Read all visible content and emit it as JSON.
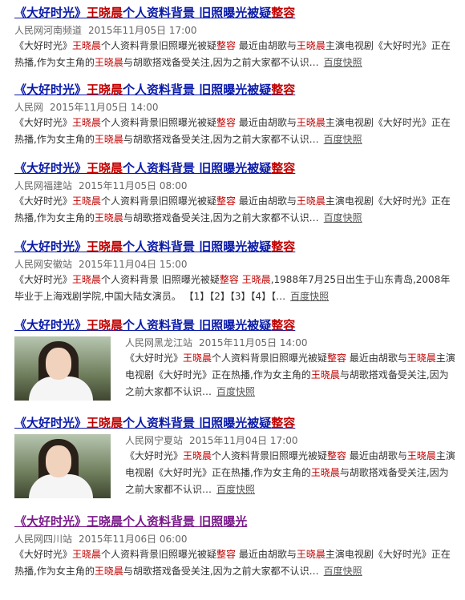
{
  "results": [
    {
      "title": [
        "《大好时光》",
        "王晓晨",
        "个人资料背景 旧照曝光被疑",
        "整容"
      ],
      "source": "人民网河南频道",
      "date": "2015年11月05日 17:00",
      "snippet": [
        "《大好时光》",
        "王晓晨",
        "个人资料背景旧照曝光被疑",
        "整容",
        " 最近由胡歌与",
        "王晓晨",
        "主演电视剧《大好时光》正在热播,作为女主角的",
        "王晓晨",
        "与胡歌搭戏备受关注,因为之前大家都不认识…"
      ],
      "cache": "百度快照"
    },
    {
      "title": [
        "《大好时光》",
        "王晓晨",
        "个人资料背景 旧照曝光被疑",
        "整容"
      ],
      "source": "人民网",
      "date": "2015年11月05日 14:00",
      "snippet": [
        "《大好时光》",
        "王晓晨",
        "个人资料背景旧照曝光被疑",
        "整容",
        " 最近由胡歌与",
        "王晓晨",
        "主演电视剧《大好时光》正在热播,作为女主角的",
        "王晓晨",
        "与胡歌搭戏备受关注,因为之前大家都不认识…"
      ],
      "cache": "百度快照"
    },
    {
      "title": [
        "《大好时光》",
        "王晓晨",
        "个人资料背景 旧照曝光被疑",
        "整容"
      ],
      "source": "人民网福建站",
      "date": "2015年11月05日 08:00",
      "snippet": [
        "《大好时光》",
        "王晓晨",
        "个人资料背景旧照曝光被疑",
        "整容",
        " 最近由胡歌与",
        "王晓晨",
        "主演电视剧《大好时光》正在热播,作为女主角的",
        "王晓晨",
        "与胡歌搭戏备受关注,因为之前大家都不认识…"
      ],
      "cache": "百度快照"
    },
    {
      "title": [
        "《大好时光》",
        "王晓晨",
        "个人资料背景 旧照曝光被疑",
        "整容"
      ],
      "source": "人民网安徽站",
      "date": "2015年11月04日 15:00",
      "snippet": [
        "《大好时光》",
        "王晓晨",
        "个人资料背景 旧照曝光被疑",
        "整容",
        " ",
        "王晓晨",
        ",1988年7月25日出生于山东青岛,2008年毕业于上海戏剧学院,中国大陆女演员。 【1】【2】【3】【4】【…",
        "",
        ""
      ],
      "cache": "百度快照"
    },
    {
      "title": [
        "《大好时光》",
        "王晓晨",
        "个人资料背景 旧照曝光被疑",
        "整容"
      ],
      "source": "人民网黑龙江站",
      "date": "2015年11月05日 14:00",
      "snippet": [
        "《大好时光》",
        "王晓晨",
        "个人资料背景旧照曝光被疑",
        "整容",
        " 最近由胡歌与",
        "王晓晨",
        "主演电视剧《大好时光》正在热播,作为女主角的",
        "王晓晨",
        "与胡歌搭戏备受关注,因为之前大家都不认识…"
      ],
      "cache": "百度快照"
    },
    {
      "title": [
        "《大好时光》",
        "王晓晨",
        "个人资料背景 旧照曝光被疑",
        "整容"
      ],
      "source": "人民网宁夏站",
      "date": "2015年11月04日 17:00",
      "snippet": [
        "《大好时光》",
        "王晓晨",
        "个人资料背景旧照曝光被疑",
        "整容",
        " 最近由胡歌与",
        "王晓晨",
        "主演电视剧《大好时光》正在热播,作为女主角的",
        "王晓晨",
        "与胡歌搭戏备受关注,因为之前大家都不认识…"
      ],
      "cache": "百度快照"
    },
    {
      "title": [
        "《大好时光》",
        "王晓晨",
        "个人资料背景 旧照曝光",
        ""
      ],
      "source": "人民网四川站",
      "date": "2015年11月06日 06:00",
      "snippet": [
        "《大好时光》",
        "王晓晨",
        "个人资料背景旧照曝光被疑",
        "整容",
        " 最近由胡歌与",
        "王晓晨",
        "主演电视剧《大好时光》正在热播,作为女主角的",
        "王晓晨",
        "与胡歌搭戏备受关注,因为之前大家都不认识…"
      ],
      "cache": "百度快照"
    }
  ]
}
